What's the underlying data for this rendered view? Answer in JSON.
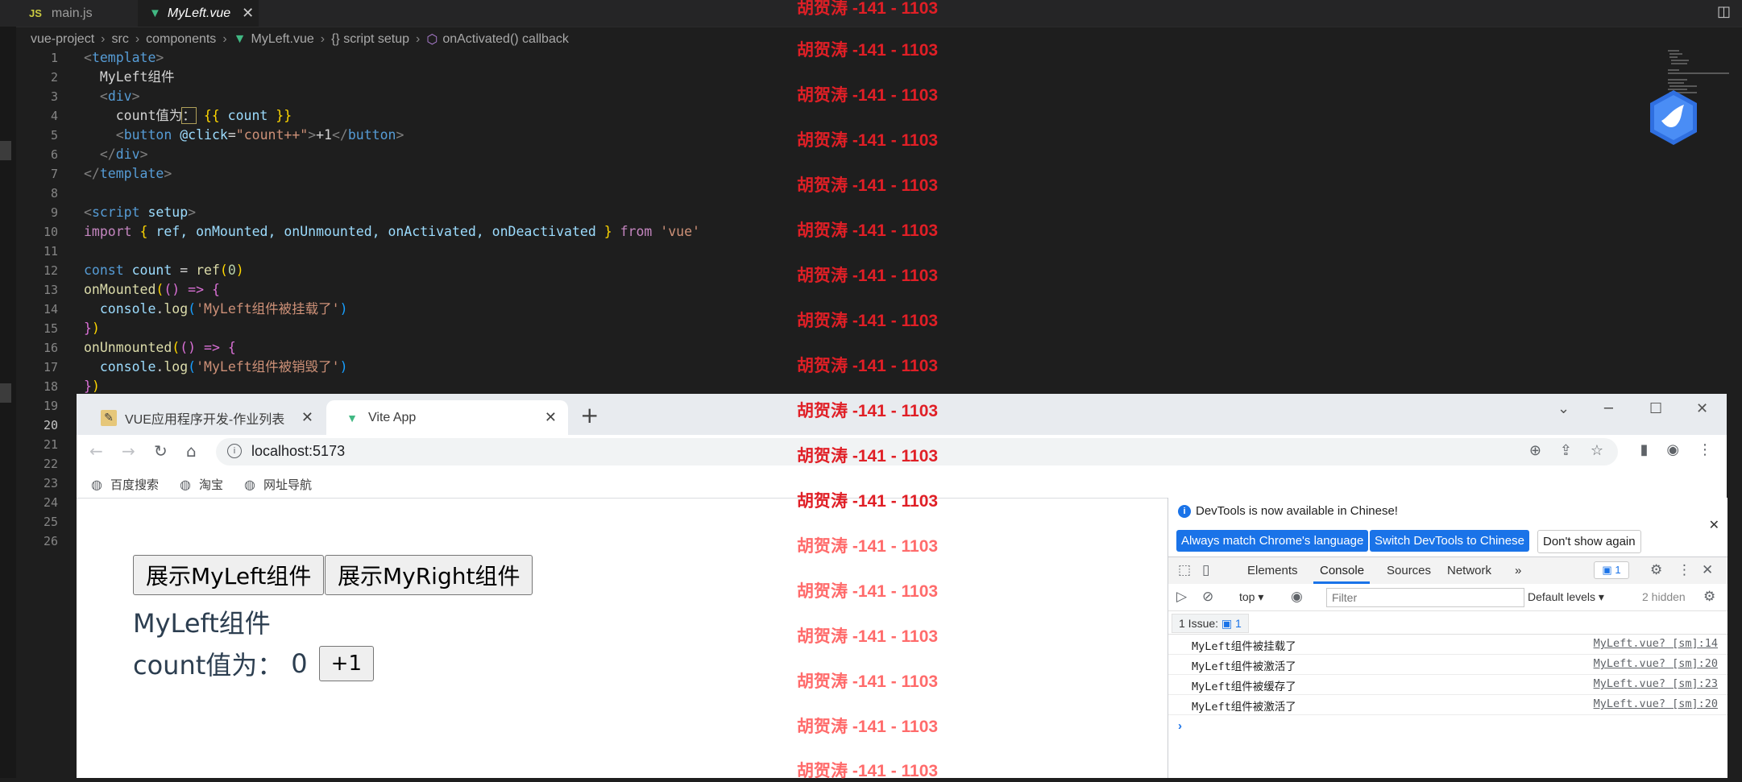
{
  "editor": {
    "tabs": [
      {
        "label": "main.js",
        "badge": "JS"
      },
      {
        "label": "MyLeft.vue",
        "close": "✕"
      }
    ],
    "breadcrumb": [
      "vue-project",
      "src",
      "components",
      "MyLeft.vue",
      "{} script setup",
      "onActivated() callback"
    ],
    "line_numbers": [
      "1",
      "2",
      "3",
      "4",
      "5",
      "6",
      "7",
      "8",
      "9",
      "10",
      "11",
      "12",
      "13",
      "14",
      "15",
      "16",
      "17",
      "18",
      "19",
      "20",
      "21",
      "22",
      "23",
      "24",
      "25",
      "26"
    ],
    "current_line": "20",
    "code": {
      "l1": {
        "open": "<",
        "tag": "template",
        "close": ">"
      },
      "l2": "MyLeft组件",
      "l3": {
        "open": "<",
        "tag": "div",
        "close": ">"
      },
      "l4": {
        "text": "count值为",
        "colon": "：",
        "mo": "{{",
        "var": "count",
        "mc": "}}"
      },
      "l5": {
        "open": "<",
        "tag": "button",
        "attr": "@click",
        "eq": "=",
        "val": "\"count++\"",
        "close": ">",
        "text": "+1",
        "end_open": "</",
        "end_close": ">"
      },
      "l6": {
        "open": "</",
        "tag": "div",
        "close": ">"
      },
      "l7": {
        "open": "</",
        "tag": "template",
        "close": ">"
      },
      "l9": {
        "open": "<",
        "tag": "script",
        "attr": "setup",
        "close": ">"
      },
      "l10": {
        "kw": "import",
        "lb": "{",
        "names": "ref, onMounted, onUnmounted, onActivated, onDeactivated",
        "rb": "}",
        "from": "from",
        "src": "'vue'"
      },
      "l12": {
        "kw": "const",
        "var": "count",
        "eq": "=",
        "fn": "ref",
        "lp": "(",
        "num": "0",
        "rp": ")"
      },
      "l13": {
        "fn": "onMounted",
        "lp": "(",
        "arrow": "() =>",
        "lb": "{"
      },
      "l14": {
        "obj": "console",
        "dot": ".",
        "fn": "log",
        "lp": "(",
        "str": "'MyLeft组件被挂载了'",
        "rp": ")"
      },
      "l15": {
        "rb": "}",
        "rp": ")"
      },
      "l16": {
        "fn": "onUnmounted",
        "lp": "(",
        "arrow": "() =>",
        "lb": "{"
      },
      "l17": {
        "obj": "console",
        "dot": ".",
        "fn": "log",
        "lp": "(",
        "str": "'MyLeft组件被销毁了'",
        "rp": ")"
      },
      "l18": {
        "rb": "}",
        "rp": ")"
      }
    }
  },
  "watermark": {
    "text": "胡贺涛 -141 - 1103"
  },
  "browser": {
    "tabs": [
      {
        "label": "VUE应用程序开发-作业列表"
      },
      {
        "label": "Vite App"
      }
    ],
    "url": "localhost:5173",
    "bookmarks": [
      "百度搜索",
      "淘宝",
      "网址导航"
    ]
  },
  "page": {
    "btn_left": "展示MyLeft组件",
    "btn_right": "展示MyRight组件",
    "comp_title": "MyLeft组件",
    "count_label": "count值为：",
    "count_value": "0",
    "inc_btn": "+1"
  },
  "devtools": {
    "notice": "DevTools is now available in Chinese!",
    "btn_match": "Always match Chrome's language",
    "btn_switch": "Switch DevTools to Chinese",
    "btn_dismiss": "Don't show again",
    "tabs": [
      "Elements",
      "Console",
      "Sources",
      "Network"
    ],
    "more": "»",
    "issues_badge": "1",
    "context": "top",
    "filter_placeholder": "Filter",
    "levels": "Default levels",
    "hidden": "2 hidden",
    "issues_label": "1 Issue:",
    "issues_count": "1",
    "messages": [
      {
        "text": "MyLeft组件被挂载了",
        "src": "MyLeft.vue? [sm]:14"
      },
      {
        "text": "MyLeft组件被激活了",
        "src": "MyLeft.vue? [sm]:20"
      },
      {
        "text": "MyLeft组件被缓存了",
        "src": "MyLeft.vue? [sm]:23"
      },
      {
        "text": "MyLeft组件被激活了",
        "src": "MyLeft.vue? [sm]:20"
      }
    ],
    "prompt": "›"
  },
  "colors": {
    "editor_bg": "#1e1e1e",
    "watermark": "#e01f26",
    "vue_green": "#41b883",
    "chrome_blue": "#1a73e8"
  },
  "icons": [
    "vue-logo-icon",
    "js-file-icon",
    "close-icon",
    "split-layout-icon",
    "back-icon",
    "forward-icon",
    "reload-icon",
    "home-icon",
    "info-icon",
    "zoom-icon",
    "share-icon",
    "star-icon",
    "sidebar-icon",
    "profile-icon",
    "menu-icon",
    "globe-icon",
    "gear-icon",
    "inspect-icon",
    "device-icon",
    "clear-console-icon",
    "eye-icon"
  ]
}
